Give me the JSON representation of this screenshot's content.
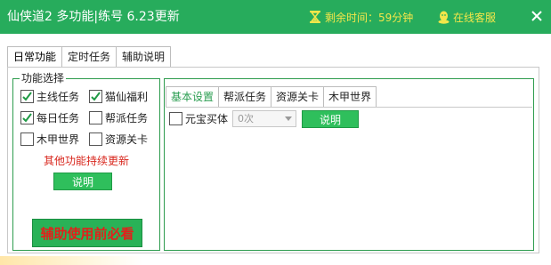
{
  "window": {
    "title": "仙侠道2 多功能|练号 6.23更新",
    "timer_text": "剩余时间：59分钟",
    "support_text": "在线客服",
    "accent_color": "#27ac5c"
  },
  "tabs": [
    {
      "label": "日常功能",
      "active": true
    },
    {
      "label": "定时任务",
      "active": false
    },
    {
      "label": "辅助说明",
      "active": false
    }
  ],
  "function_group": {
    "legend": "功能选择",
    "options": [
      {
        "label": "主线任务",
        "checked": true
      },
      {
        "label": "猫仙福利",
        "checked": true
      },
      {
        "label": "每日任务",
        "checked": true
      },
      {
        "label": "帮派任务",
        "checked": false
      },
      {
        "label": "木甲世界",
        "checked": false
      },
      {
        "label": "资源关卡",
        "checked": false
      }
    ],
    "note": "其他功能持续更新",
    "explain_button": "说明",
    "must_read_button": "辅助使用前必看"
  },
  "sub_tabs": [
    {
      "label": "基本设置",
      "active": true
    },
    {
      "label": "帮派任务",
      "active": false
    },
    {
      "label": "资源关卡",
      "active": false
    },
    {
      "label": "木甲世界",
      "active": false
    }
  ],
  "basic_settings": {
    "yuanbao_label": "元宝买体",
    "yuanbao_checked": false,
    "count_select": "0次",
    "explain_button": "说明"
  }
}
